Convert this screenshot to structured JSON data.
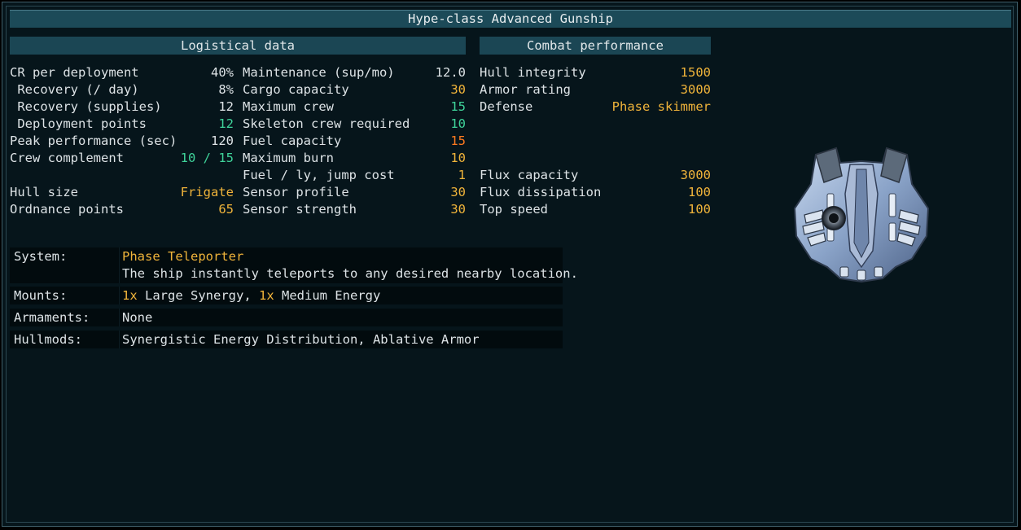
{
  "title": "Hype-class Advanced Gunship",
  "logistical": {
    "header": "Logistical data",
    "col1": [
      {
        "label": "CR per deployment",
        "value": "40%",
        "color": "w"
      },
      {
        "label": " Recovery (/ day)",
        "value": "8%",
        "color": "w"
      },
      {
        "label": " Recovery (supplies)",
        "value": "12",
        "color": "w"
      },
      {
        "label": " Deployment points",
        "value": "12",
        "color": "g"
      },
      {
        "label": "Peak performance (sec)",
        "value": "120",
        "color": "w"
      },
      {
        "label": "Crew complement",
        "value_a": "10",
        "value_sep": " / ",
        "value_b": "15",
        "color": "g"
      },
      {
        "label": "Hull size",
        "value": "Frigate",
        "color": "y"
      },
      {
        "label": "Ordnance points",
        "value": "65",
        "color": "y"
      }
    ],
    "col2": [
      {
        "label": "Maintenance (sup/mo)",
        "value": "12.0",
        "color": "w"
      },
      {
        "label": "Cargo capacity",
        "value": "30",
        "color": "y"
      },
      {
        "label": "Maximum crew",
        "value": "15",
        "color": "g"
      },
      {
        "label": "Skeleton crew required",
        "value": "10",
        "color": "g"
      },
      {
        "label": "Fuel capacity",
        "value": "15",
        "color": "o"
      },
      {
        "label": "Maximum burn",
        "value": "10",
        "color": "y"
      },
      {
        "label": "Fuel / ly, jump cost",
        "value": "1",
        "color": "y"
      },
      {
        "label": "Sensor profile",
        "value": "30",
        "color": "y"
      },
      {
        "label": "Sensor strength",
        "value": "30",
        "color": "y"
      }
    ]
  },
  "combat": {
    "header": "Combat performance",
    "rows": [
      {
        "label": "Hull integrity",
        "value": "1500",
        "color": "y"
      },
      {
        "label": "Armor rating",
        "value": "3000",
        "color": "y"
      },
      {
        "label": "Defense",
        "value": "Phase skimmer",
        "color": "y"
      },
      {
        "label": "Flux capacity",
        "value": "3000",
        "color": "y"
      },
      {
        "label": "Flux dissipation",
        "value": "100",
        "color": "y"
      },
      {
        "label": "Top speed",
        "value": "100",
        "color": "y"
      }
    ]
  },
  "info": {
    "system_label": "System:",
    "system_name": "Phase Teleporter",
    "system_desc": "The ship instantly teleports to any desired nearby location.",
    "mounts_label": "Mounts:",
    "mounts_qty1": "1x",
    "mounts_name1": " Large Synergy, ",
    "mounts_qty2": "1x",
    "mounts_name2": " Medium Energy",
    "armaments_label": "Armaments:",
    "armaments_value": "None",
    "hullmods_label": "Hullmods:",
    "hullmods_value": "Synergistic Energy Distribution, Ablative Armor"
  },
  "colors": {
    "highlight_yellow": "#f0b43a",
    "highlight_green": "#3fd39a",
    "highlight_orange": "#ff7a1f",
    "header_bg": "#1b4654"
  },
  "ship_image": "ship-sprite"
}
